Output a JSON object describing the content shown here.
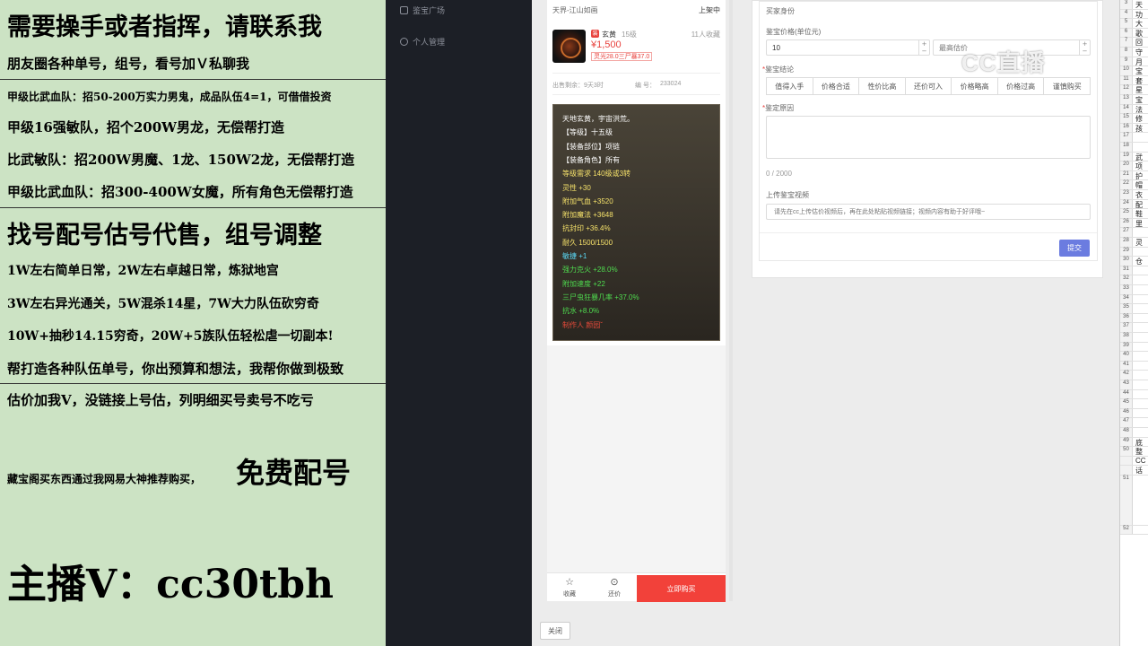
{
  "overlay": {
    "lines": [
      "需要操手或者指挥，请联系我",
      "朋友圈各种单号，组号，看号加Ｖ私聊我",
      "甲级比武血队：招50-200万实力男鬼，成品队伍4=1，可借借投资",
      "甲级16强敏队，招个200W男龙，无偿帮打造",
      "比武敏队：招200W男魔、1龙、150W2龙，无偿帮打造",
      "甲级比武血队：招300-400W女魔，所有角色无偿帮打造",
      "找号配号估号代售，组号调整",
      "1W左右简单日常，2W左右卓越日常，炼狱地宫",
      "3W左右异光通关，5W混杀14星，7W大力队伍砍穷奇",
      "10W+抽秒14.15穷奇，20W+5族队伍轻松虐一切副本!",
      "帮打造各种队伍单号，你出预算和想法，我帮你做到极致",
      "估价加我V，没链接上号估，列明细买号卖号不吃亏",
      "藏宝阁买东西通过我网易大神推荐购买，",
      "免费配号",
      "主播V：cc30tbh"
    ]
  },
  "sidebar": {
    "items": [
      {
        "label": "鉴宝广场",
        "icon": "box-icon"
      },
      {
        "label": "个人管理",
        "icon": "user-icon"
      }
    ]
  },
  "listing": {
    "server": "天界-江山如画",
    "status": "上架中",
    "badge": "装",
    "name": "玄黄",
    "level": "15级",
    "favorites": "11人收藏",
    "price": "¥1,500",
    "tag": "灵光28.0三尸暴37.0",
    "remaining": "出售剩余：9天3时",
    "id_label": "编  号：",
    "id_value": "233024"
  },
  "attributes": [
    {
      "text": "天地玄黄，宇宙洪荒。",
      "color": "#ffffff"
    },
    {
      "text": "【等级】十五级",
      "color": "#ffffff"
    },
    {
      "text": "【装备部位】项链",
      "color": "#ffffff"
    },
    {
      "text": "【装备角色】所有",
      "color": "#ffffff"
    },
    {
      "text": "等级需求 140级或3转",
      "color": "#f5e16a"
    },
    {
      "text": "灵性 +30",
      "color": "#f5e16a"
    },
    {
      "text": "附加气血 +3520",
      "color": "#f5e16a"
    },
    {
      "text": "附加魔法 +3648",
      "color": "#f5e16a"
    },
    {
      "text": "抗封印 +36.4%",
      "color": "#f5e16a"
    },
    {
      "text": "耐久 1500/1500",
      "color": "#f5e16a"
    },
    {
      "text": "敏捷 +1",
      "color": "#5ad8f5"
    },
    {
      "text": "强力克火 +28.0%",
      "color": "#4fdc4f"
    },
    {
      "text": "附加速度 +22",
      "color": "#4fdc4f"
    },
    {
      "text": "三尸虫狂暴几率 +37.0%",
      "color": "#4fdc4f"
    },
    {
      "text": "抗水 +8.0%",
      "color": "#4fdc4f"
    },
    {
      "text": "制作人 颜园ˇ",
      "color": "#e84a3a"
    }
  ],
  "bottom_bar": {
    "favorite_label": "收藏",
    "bargain_label": "还价",
    "buy_label": "立即购买"
  },
  "close_label": "关闭",
  "form": {
    "identity_label": "买家身份",
    "price_label": "鉴宝价格(单位元)",
    "price_value": "10",
    "max_price_placeholder": "最高估价",
    "verdict_label": "鉴宝结论",
    "verdicts": [
      "值得入手",
      "价格合适",
      "性价比高",
      "还价可入",
      "价格略高",
      "价格过高",
      "谨慎购买"
    ],
    "reason_label": "鉴定原因",
    "char_count": "0 / 2000",
    "video_label": "上传鉴宝视频",
    "video_placeholder": "请先在cc上传估价视频后，再在此处粘贴视频链接；视频内容有助于好评哦~",
    "submit_label": "提交"
  },
  "watermark": "CC直播",
  "sheet": {
    "rows": [
      {
        "n": "3",
        "v": "天"
      },
      {
        "n": "4",
        "v": "功"
      },
      {
        "n": "5",
        "v": "大"
      },
      {
        "n": "6",
        "v": "歌"
      },
      {
        "n": "7",
        "v": "回"
      },
      {
        "n": "8",
        "v": "守"
      },
      {
        "n": "9",
        "v": "月"
      },
      {
        "n": "10",
        "v": "宝"
      },
      {
        "n": "11",
        "v": "套"
      },
      {
        "n": "12",
        "v": "星"
      },
      {
        "n": "13",
        "v": "宝"
      },
      {
        "n": "14",
        "v": "法"
      },
      {
        "n": "15",
        "v": "修"
      },
      {
        "n": "16",
        "v": "孩"
      },
      {
        "n": "17",
        "v": ""
      },
      {
        "n": "18",
        "v": ""
      },
      {
        "n": "19",
        "v": "武"
      },
      {
        "n": "20",
        "v": "项"
      },
      {
        "n": "21",
        "v": "护"
      },
      {
        "n": "22",
        "v": "帽"
      },
      {
        "n": "23",
        "v": "衣"
      },
      {
        "n": "24",
        "v": "配"
      },
      {
        "n": "25",
        "v": "鞋"
      },
      {
        "n": "26",
        "v": "里"
      },
      {
        "n": "27",
        "v": ""
      },
      {
        "n": "28",
        "v": "灵"
      },
      {
        "n": "29",
        "v": ""
      },
      {
        "n": "30",
        "v": "仓"
      },
      {
        "n": "31",
        "v": ""
      },
      {
        "n": "32",
        "v": ""
      },
      {
        "n": "33",
        "v": ""
      },
      {
        "n": "34",
        "v": ""
      },
      {
        "n": "35",
        "v": ""
      },
      {
        "n": "36",
        "v": ""
      },
      {
        "n": "37",
        "v": ""
      },
      {
        "n": "38",
        "v": ""
      },
      {
        "n": "39",
        "v": ""
      },
      {
        "n": "40",
        "v": ""
      },
      {
        "n": "41",
        "v": ""
      },
      {
        "n": "42",
        "v": ""
      },
      {
        "n": "43",
        "v": ""
      },
      {
        "n": "44",
        "v": ""
      },
      {
        "n": "45",
        "v": ""
      },
      {
        "n": "46",
        "v": ""
      },
      {
        "n": "47",
        "v": ""
      },
      {
        "n": "48",
        "v": ""
      },
      {
        "n": "49",
        "v": "底"
      },
      {
        "n": "50",
        "v": "整"
      },
      {
        "n": "",
        "v": "CC"
      },
      {
        "n": "",
        "v": "话"
      },
      {
        "n": "51",
        "v": ""
      },
      {
        "n": "52",
        "v": ""
      }
    ]
  }
}
